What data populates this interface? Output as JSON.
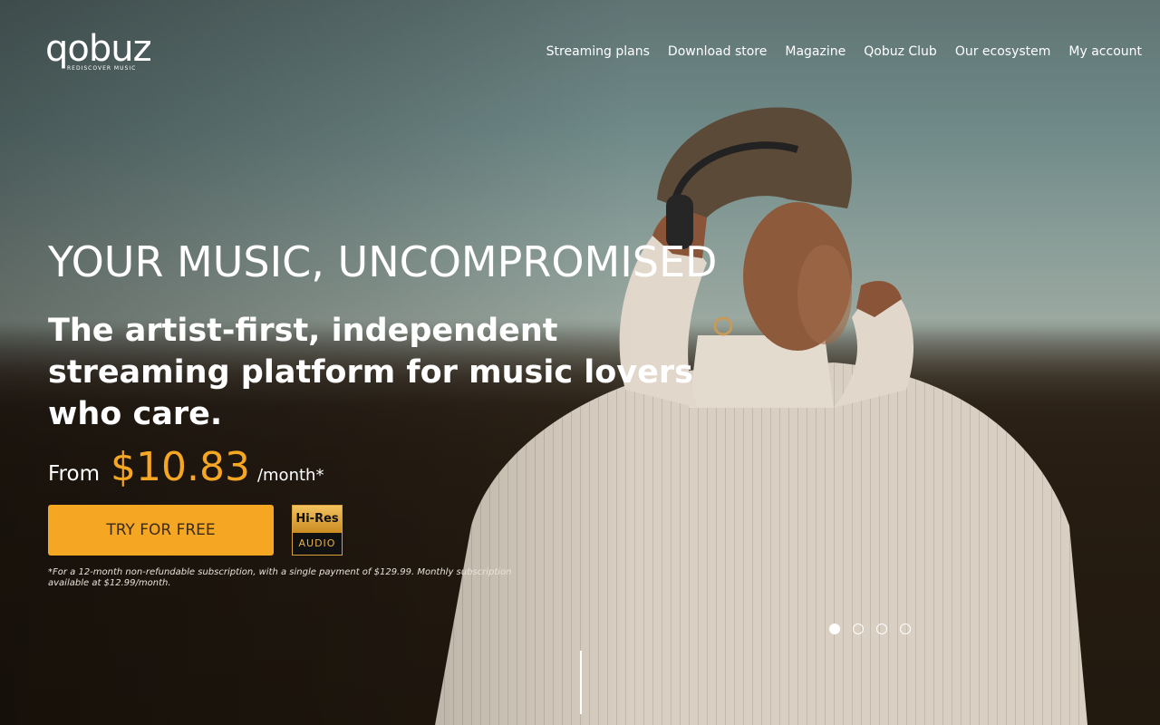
{
  "brand": {
    "name": "qobuz",
    "tagline": "REDISCOVER MUSIC"
  },
  "nav": {
    "items": [
      {
        "label": "Streaming plans"
      },
      {
        "label": "Download store"
      },
      {
        "label": "Magazine"
      },
      {
        "label": "Qobuz Club"
      },
      {
        "label": "Our ecosystem"
      },
      {
        "label": "My account"
      }
    ]
  },
  "hero": {
    "headline": "YOUR MUSIC, UNCOMPROMISED",
    "subhead": "The artist-first, independent streaming platform for music lovers who care.",
    "price_prefix": "From",
    "price_value": "$10.83",
    "price_suffix": "/month*",
    "cta_label": "TRY FOR FREE",
    "badge": {
      "top": "Hi-Res",
      "bottom": "AUDIO"
    },
    "footnote": "*For a 12-month non-refundable subscription, with a single payment of $129.99. Monthly subscription available at $12.99/month."
  },
  "carousel": {
    "slide_count": 4,
    "active_index": 0
  },
  "colors": {
    "accent": "#f5a623",
    "text": "#ffffff"
  }
}
